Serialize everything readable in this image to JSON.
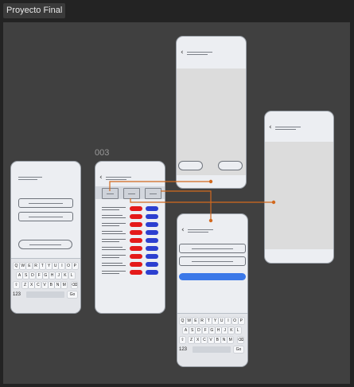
{
  "tab": {
    "title": "Proyecto Final"
  },
  "frame_label": "003",
  "keyboard": {
    "row1": [
      "Q",
      "W",
      "E",
      "R",
      "T",
      "Y",
      "U",
      "I",
      "O",
      "P"
    ],
    "row2": [
      "A",
      "S",
      "D",
      "F",
      "G",
      "H",
      "J",
      "K",
      "L"
    ],
    "row3": [
      "Z",
      "X",
      "C",
      "V",
      "B",
      "N",
      "M"
    ],
    "numbers_key": "123",
    "go_key": "Go"
  },
  "icons": {
    "back": "chevron-left-icon",
    "shift": "shift-icon",
    "delete": "backspace-icon"
  },
  "colors": {
    "connector": "#d2691e",
    "red_button": "#e41a1a",
    "blue_button": "#2c3fd0",
    "primary": "#3b78e8"
  }
}
